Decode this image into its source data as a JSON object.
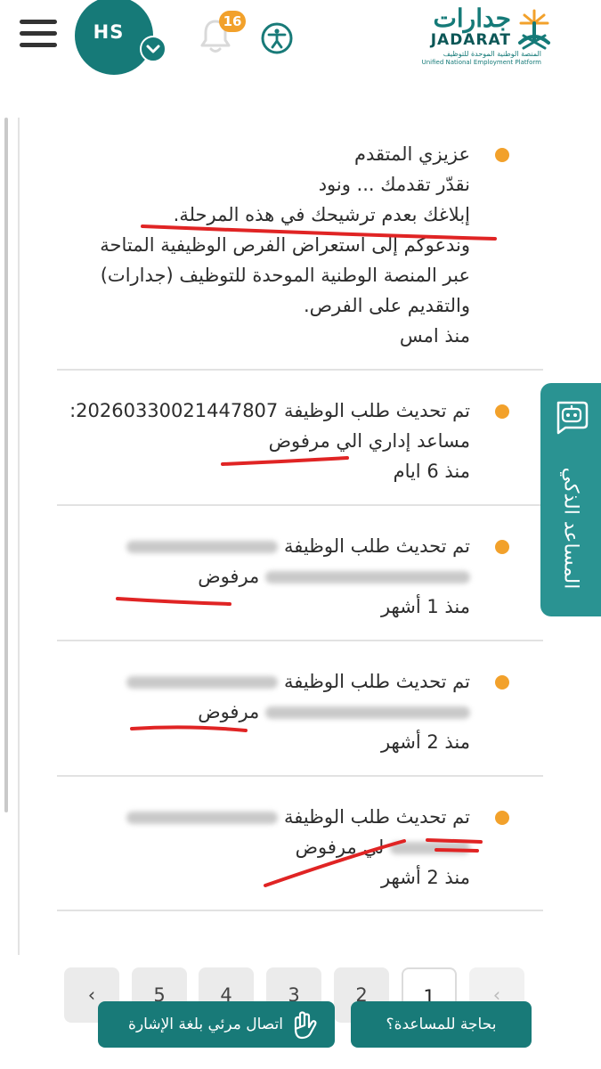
{
  "header": {
    "avatar_initials": "HS",
    "notification_count": "16",
    "logo": {
      "arabic": "جدارات",
      "english": "JADARAT",
      "subtitle_ar": "المنصة الوطنية الموحدة للتوظيف",
      "subtitle_en": "Unified National Employment Platform"
    }
  },
  "notifications": [
    {
      "lines": [
        "عزيزي المتقدم",
        "نقدّر تقدمك ... ونود",
        "إبلاغك بعدم ترشيحك في هذه المرحلة.",
        "وندعوكم إلى استعراض الفرص الوظيفية المتاحة",
        "عبر المنصة الوطنية الموحدة للتوظيف (جدارات)",
        "والتقديم على الفرص."
      ],
      "time": "منذ امس"
    },
    {
      "line1": "تم تحديث طلب الوظيفة 20260330021447807:",
      "line2": "مساعد إداري الي  مرفوض",
      "time": "منذ 6 ايام"
    },
    {
      "line1": "تم تحديث طلب الوظيفة",
      "status": "مرفوض",
      "time": "منذ 1 أشهر"
    },
    {
      "line1": "تم تحديث طلب الوظيفة",
      "status": "مرفوض",
      "time": "منذ 2 أشهر"
    },
    {
      "line1": "تم تحديث طلب الوظيفة",
      "status": "لي مرفوض",
      "time": "منذ 2 أشهر"
    }
  ],
  "assistant": {
    "label": "المساعد الذكي"
  },
  "pagination": {
    "pages": [
      "1",
      "2",
      "3",
      "4",
      "5"
    ],
    "prev": "‹",
    "next": "‹",
    "current": "1"
  },
  "buttons": {
    "sign_language": "اتصال مرئي بلغة الإشارة",
    "help": "بحاجة للمساعدة؟"
  },
  "colors": {
    "primary": "#187a78",
    "accent": "#f2a12b",
    "annotation": "#e02424"
  }
}
